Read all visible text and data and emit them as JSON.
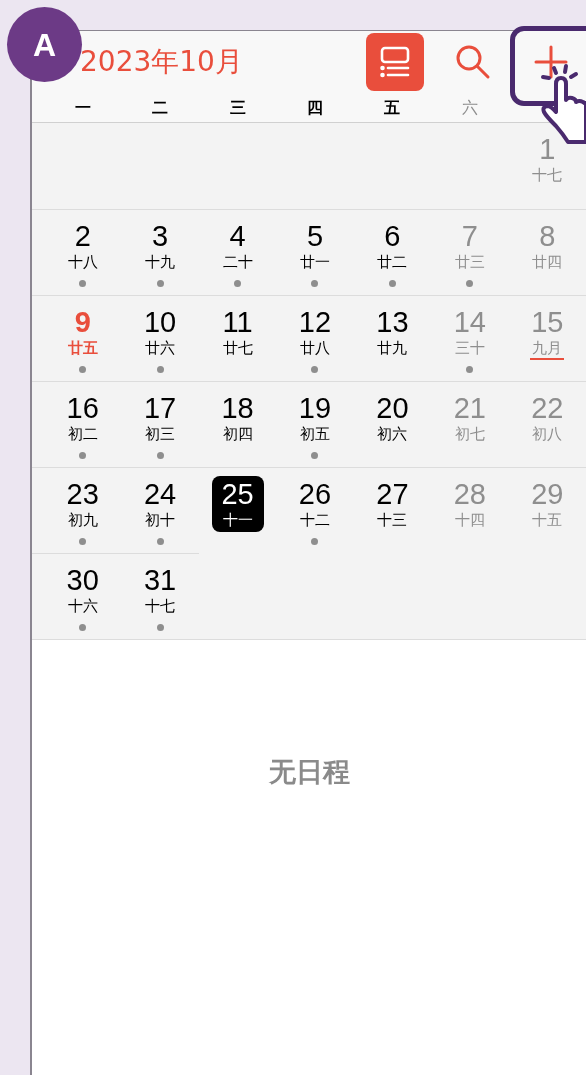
{
  "step_badge": "A",
  "header": {
    "title": "2023年10月",
    "buttons": [
      {
        "kind": "list",
        "selected": true
      },
      {
        "kind": "search",
        "selected": false
      },
      {
        "kind": "add",
        "selected": false
      }
    ]
  },
  "weekdays": [
    {
      "label": "一",
      "weekend": false
    },
    {
      "label": "二",
      "weekend": false
    },
    {
      "label": "三",
      "weekend": false
    },
    {
      "label": "四",
      "weekend": false
    },
    {
      "label": "五",
      "weekend": false
    },
    {
      "label": "六",
      "weekend": true
    }
  ],
  "weeks": [
    {
      "kind": "first",
      "days": [
        {
          "day": "1",
          "lunar": "十七",
          "kind": "weekend",
          "selected": false,
          "event": false,
          "month_start": false
        }
      ]
    },
    {
      "kind": "full",
      "days": [
        {
          "day": "2",
          "lunar": "十八",
          "kind": "weekday",
          "selected": false,
          "event": true,
          "month_start": false
        },
        {
          "day": "3",
          "lunar": "十九",
          "kind": "weekday",
          "selected": false,
          "event": true,
          "month_start": false
        },
        {
          "day": "4",
          "lunar": "二十",
          "kind": "weekday",
          "selected": false,
          "event": true,
          "month_start": false
        },
        {
          "day": "5",
          "lunar": "廿一",
          "kind": "weekday",
          "selected": false,
          "event": true,
          "month_start": false
        },
        {
          "day": "6",
          "lunar": "廿二",
          "kind": "weekday",
          "selected": false,
          "event": true,
          "month_start": false
        },
        {
          "day": "7",
          "lunar": "廿三",
          "kind": "weekend",
          "selected": false,
          "event": true,
          "month_start": false
        },
        {
          "day": "8",
          "lunar": "廿四",
          "kind": "weekend",
          "selected": false,
          "event": false,
          "month_start": false
        }
      ]
    },
    {
      "kind": "full",
      "days": [
        {
          "day": "9",
          "lunar": "廿五",
          "kind": "holiday",
          "selected": false,
          "event": true,
          "month_start": false
        },
        {
          "day": "10",
          "lunar": "廿六",
          "kind": "weekday",
          "selected": false,
          "event": true,
          "month_start": false
        },
        {
          "day": "11",
          "lunar": "廿七",
          "kind": "weekday",
          "selected": false,
          "event": false,
          "month_start": false
        },
        {
          "day": "12",
          "lunar": "廿八",
          "kind": "weekday",
          "selected": false,
          "event": true,
          "month_start": false
        },
        {
          "day": "13",
          "lunar": "廿九",
          "kind": "weekday",
          "selected": false,
          "event": false,
          "month_start": false
        },
        {
          "day": "14",
          "lunar": "三十",
          "kind": "weekend",
          "selected": false,
          "event": true,
          "month_start": false
        },
        {
          "day": "15",
          "lunar": "九月",
          "kind": "weekend",
          "selected": false,
          "event": false,
          "month_start": true
        }
      ]
    },
    {
      "kind": "full",
      "days": [
        {
          "day": "16",
          "lunar": "初二",
          "kind": "weekday",
          "selected": false,
          "event": true,
          "month_start": false
        },
        {
          "day": "17",
          "lunar": "初三",
          "kind": "weekday",
          "selected": false,
          "event": true,
          "month_start": false
        },
        {
          "day": "18",
          "lunar": "初四",
          "kind": "weekday",
          "selected": false,
          "event": false,
          "month_start": false
        },
        {
          "day": "19",
          "lunar": "初五",
          "kind": "weekday",
          "selected": false,
          "event": true,
          "month_start": false
        },
        {
          "day": "20",
          "lunar": "初六",
          "kind": "weekday",
          "selected": false,
          "event": false,
          "month_start": false
        },
        {
          "day": "21",
          "lunar": "初七",
          "kind": "weekend",
          "selected": false,
          "event": false,
          "month_start": false
        },
        {
          "day": "22",
          "lunar": "初八",
          "kind": "weekend",
          "selected": false,
          "event": false,
          "month_start": false
        }
      ]
    },
    {
      "kind": "full",
      "days": [
        {
          "day": "23",
          "lunar": "初九",
          "kind": "weekday",
          "selected": false,
          "event": true,
          "month_start": false
        },
        {
          "day": "24",
          "lunar": "初十",
          "kind": "weekday",
          "selected": false,
          "event": true,
          "month_start": false
        },
        {
          "day": "25",
          "lunar": "十一",
          "kind": "weekday",
          "selected": true,
          "event": false,
          "month_start": false
        },
        {
          "day": "26",
          "lunar": "十二",
          "kind": "weekday",
          "selected": false,
          "event": true,
          "month_start": false
        },
        {
          "day": "27",
          "lunar": "十三",
          "kind": "weekday",
          "selected": false,
          "event": false,
          "month_start": false
        },
        {
          "day": "28",
          "lunar": "十四",
          "kind": "weekend",
          "selected": false,
          "event": false,
          "month_start": false
        },
        {
          "day": "29",
          "lunar": "十五",
          "kind": "weekend",
          "selected": false,
          "event": false,
          "month_start": false
        }
      ]
    },
    {
      "kind": "last",
      "days": [
        {
          "day": "30",
          "lunar": "十六",
          "kind": "weekday",
          "selected": false,
          "event": true,
          "month_start": false
        },
        {
          "day": "31",
          "lunar": "十七",
          "kind": "weekday",
          "selected": false,
          "event": true,
          "month_start": false
        }
      ]
    }
  ],
  "empty_state": "无日程"
}
